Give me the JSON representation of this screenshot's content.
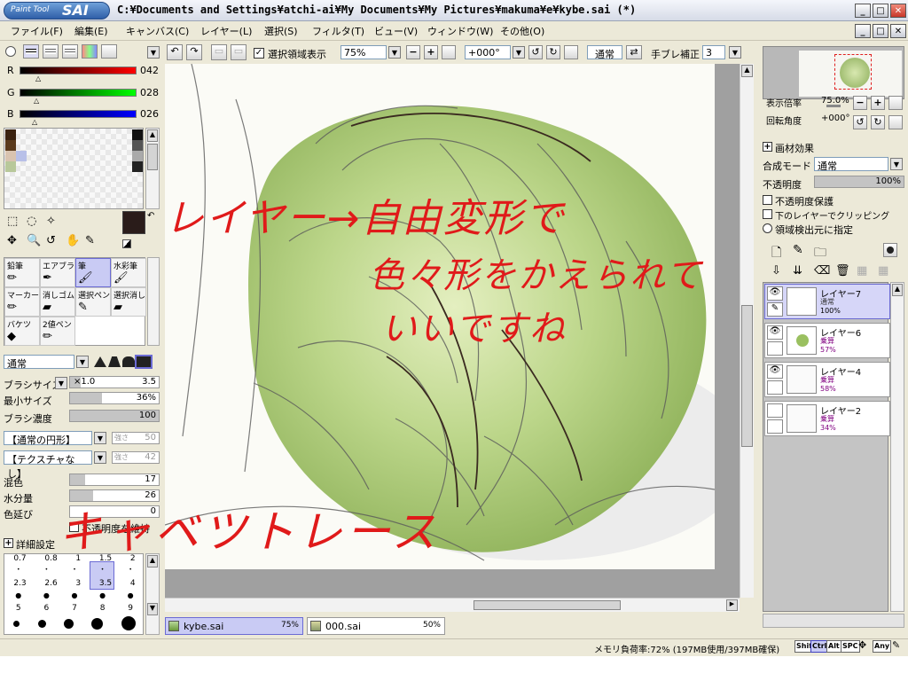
{
  "window": {
    "title": "C:¥Documents and Settings¥atchi-ai¥My Documents¥My Pictures¥makuma¥e¥kybe.sai (*)",
    "logo_small": "Paint Tool",
    "logo_big": "SAI"
  },
  "menu": [
    "ファイル(F)",
    "編集(E)",
    "キャンバス(C)",
    "レイヤー(L)",
    "選択(S)",
    "フィルタ(T)",
    "ビュー(V)",
    "ウィンドウ(W)",
    "その他(O)"
  ],
  "toolbar": {
    "selection_check": "選択領域表示",
    "zoom": "75%",
    "rotation": "+000°",
    "blend": "通常",
    "stab_label": "手ブレ補正",
    "stab_value": "3"
  },
  "color": {
    "r_label": "R",
    "r_value": "042",
    "g_label": "G",
    "g_value": "028",
    "b_label": "B",
    "b_value": "026",
    "r": 42,
    "g": 28,
    "b": 26,
    "primary": "#2a1c1a"
  },
  "tools": [
    "鉛筆",
    "エアブラシ",
    "筆",
    "水彩筆",
    "マーカー",
    "消しゴム",
    "選択ペン",
    "選択消し",
    "バケツ",
    "2値ペン"
  ],
  "brush": {
    "mode": "通常",
    "size_label": "ブラシサイズ",
    "size_mult": "×1.0",
    "size_value": "3.5",
    "min_label": "最小サイズ",
    "min_value": "36%",
    "min_frac": 0.36,
    "density_label": "ブラシ濃度",
    "density_value": "100",
    "shape": "【通常の円形】",
    "shape_strength_label": "強さ",
    "shape_strength": "50",
    "texture": "【テクスチャなし】",
    "texture_strength_label": "強さ",
    "texture_strength": "42",
    "mix_label": "混色",
    "mix_value": "17",
    "water_label": "水分量",
    "water_value": "26",
    "ext_label": "色延び",
    "ext_value": "0",
    "keep_opacity": "不透明度を維持",
    "detail": "詳細設定",
    "sizes_row1": [
      "0.7",
      "0.8",
      "1",
      "1.5",
      "2"
    ],
    "sizes_row2": [
      "2.3",
      "2.6",
      "3",
      "3.5",
      "4"
    ],
    "sizes_row3": [
      "5",
      "6",
      "7",
      "8",
      "9"
    ]
  },
  "navigator": {
    "zoom_label": "表示倍率",
    "zoom_value": "75.0%",
    "rot_label": "回転角度",
    "rot_value": "+000°"
  },
  "layer_panel": {
    "effect": "画材効果",
    "blend_label": "合成モード",
    "blend": "通常",
    "opacity_label": "不透明度",
    "opacity_value": "100%",
    "protect": "不透明度保護",
    "clip": "下のレイヤーでクリッピング",
    "detect": "領域検出元に指定",
    "layers": [
      {
        "name": "レイヤー7",
        "mode": "通常",
        "opacity": "100%"
      },
      {
        "name": "レイヤー6",
        "mode": "乗算",
        "opacity": "57%"
      },
      {
        "name": "レイヤー4",
        "mode": "乗算",
        "opacity": "58%"
      },
      {
        "name": "レイヤー2",
        "mode": "乗算",
        "opacity": "34%"
      }
    ]
  },
  "canvas": {
    "note1": "レイヤー→自由変形で",
    "note2": "色々形をかえられて",
    "note3": "いいですね",
    "note4": "キャベツトレース"
  },
  "tabs": [
    {
      "name": "kybe.sai",
      "zoom": "75%"
    },
    {
      "name": "000.sai",
      "zoom": "50%"
    }
  ],
  "status": {
    "memory": "メモリ負荷率:72% (197MB使用/397MB確保)",
    "keys": [
      "Shift",
      "Ctrl",
      "Alt",
      "SPC",
      "Any"
    ]
  }
}
